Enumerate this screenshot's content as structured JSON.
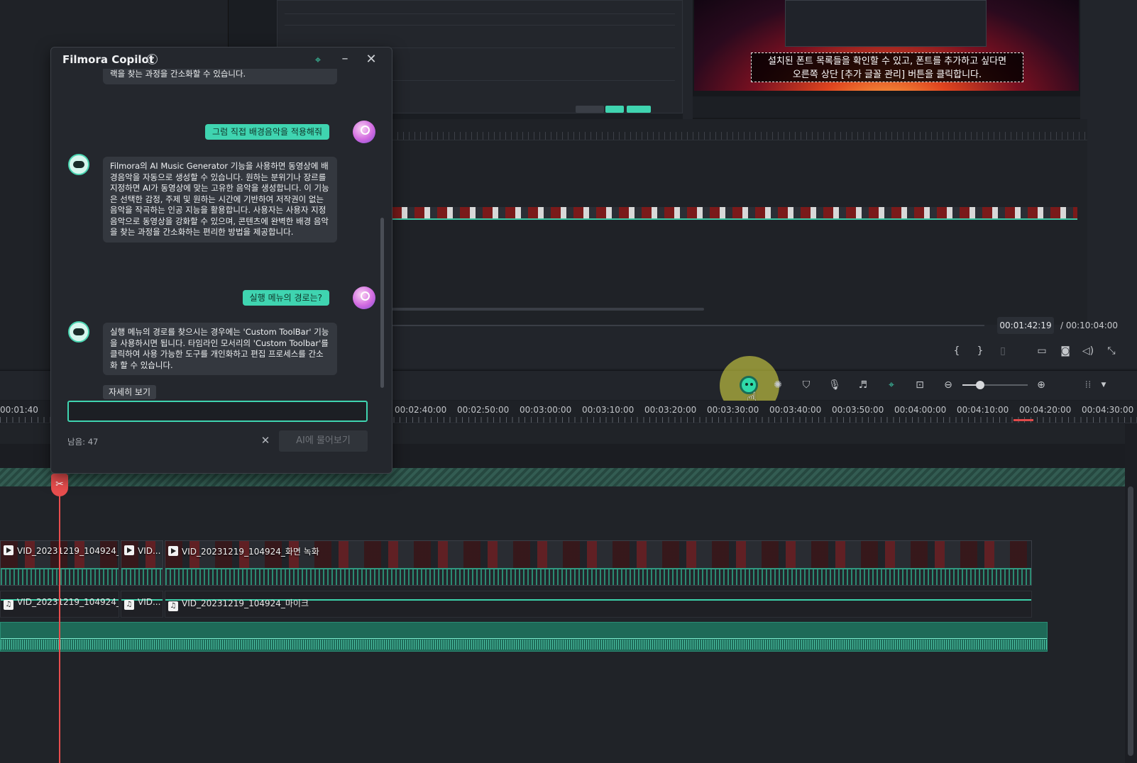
{
  "preview": {
    "subtitle_line1": "설치된 폰트 목록들을 확인할 수 있고, 폰트를 추가하고 싶다면",
    "subtitle_line2": "오른쪽 상단 [추가 글꼴 관리] 버튼을 클릭합니다.",
    "current_time": "00:01:42:19",
    "total_time": "/ 00:10:04:00"
  },
  "toolbar": {
    "icons": [
      "copilot-icon",
      "auto-beat-icon",
      "marker-icon",
      "voiceover-icon",
      "audio-mix-icon",
      "snap-icon",
      "fit-icon",
      "zoom-out-icon",
      "zoom-in-icon",
      "layout-icon"
    ]
  },
  "ruler": {
    "labels": [
      "00:01:40",
      "00:02:40:00",
      "00:02:50:00",
      "00:03:00:00",
      "00:03:10:00",
      "00:03:20:00",
      "00:03:30:00",
      "00:03:40:00",
      "00:03:50:00",
      "00:04:00:00",
      "00:04:10:00",
      "00:04:20:00",
      "00:04:30:00"
    ]
  },
  "tracks": {
    "video_clips": [
      "VID_20231219_104924_...",
      "VID...",
      "VID_20231219_104924_화면 녹화"
    ],
    "audio_clips": [
      "VID_20231219_104924_...",
      "VID...",
      "VID_20231219_104924_마이크"
    ]
  },
  "copilot": {
    "title": "Filmora Copilot",
    "messages": [
      {
        "role": "bot",
        "text": "랙을 찾는 과정을 간소화할 수 있습니다."
      },
      {
        "role": "user",
        "text": "그럼 직접 배경음악을 적용해줘"
      },
      {
        "role": "bot",
        "text": "Filmora의 AI Music Generator 기능을 사용하면 동영상에 배경음악을 자동으로 생성할 수 있습니다. 원하는 분위기나 장르를 지정하면 AI가 동영상에 맞는 고유한 음악을 생성합니다. 이 기능은 선택한 감정, 주제 및 원하는 시간에 기반하여 저작권이 없는 음악을 작곡하는 인공 지능을 활용합니다. 사용자는 사용자 지정 음악으로 동영상을 강화할 수 있으며, 콘텐츠에 완벽한 배경 음악을 찾는 과정을 간소화하는 편리한 방법을 제공합니다."
      },
      {
        "role": "user",
        "text": "실행 메뉴의 경로는?"
      },
      {
        "role": "bot",
        "text": "실행 메뉴의 경로를 찾으시는 경우에는 'Custom ToolBar' 기능을 사용하시면 됩니다. 타임라인 모서리의 'Custom Toolbar'를 클릭하여 사용 가능한 도구를 개인화하고 편집 프로세스를 간소화 할 수 있습니다."
      }
    ],
    "more_label": "자세히 보기",
    "input_value": "",
    "remaining": "남음: 47",
    "ask_label": "AI에 물어보기"
  },
  "colors": {
    "accent": "#3fd4b0",
    "playhead": "#e84e4e",
    "highlight": "#e8e846"
  }
}
